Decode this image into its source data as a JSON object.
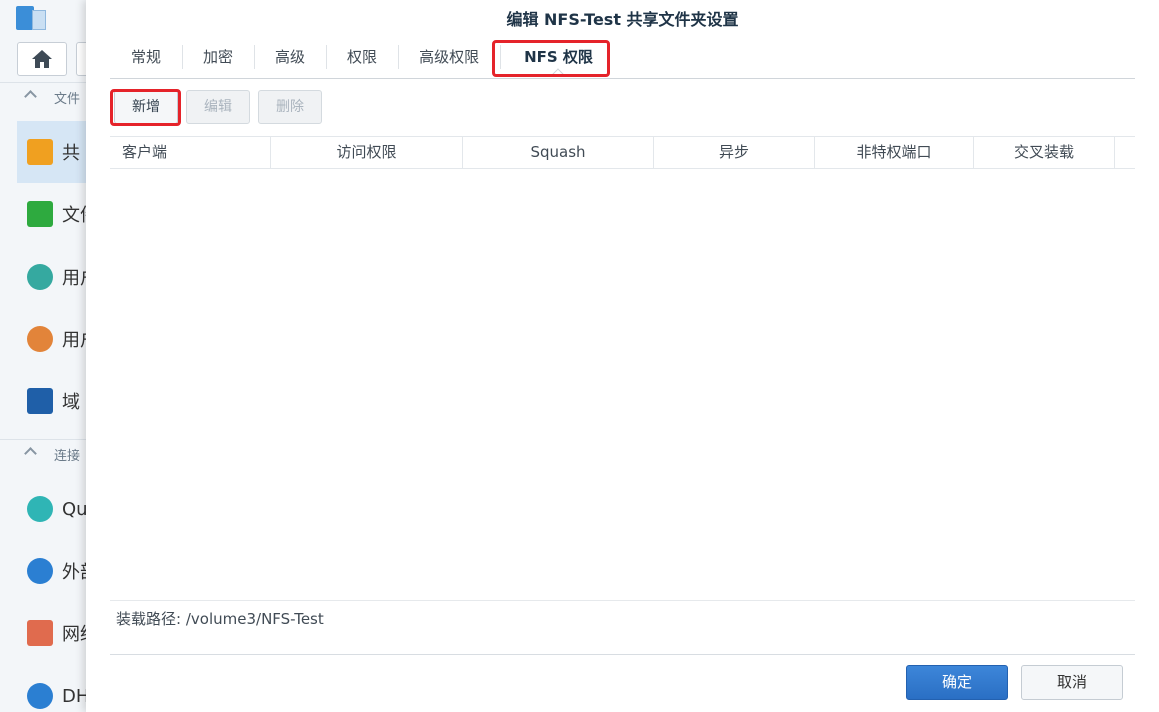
{
  "background": {
    "sections": [
      {
        "label": "文件"
      },
      {
        "label": "连接"
      }
    ],
    "items": [
      {
        "label": "共",
        "icon": "shared-folder-icon",
        "color": "#f0a020"
      },
      {
        "label": "文件",
        "icon": "file-services-icon",
        "color": "#2eaa3f"
      },
      {
        "label": "用户",
        "icon": "user-icon",
        "color": "#35a9a0"
      },
      {
        "label": "用户",
        "icon": "group-icon",
        "color": "#e2843a"
      },
      {
        "label": "域",
        "icon": "domain-icon",
        "color": "#1f5fa8"
      },
      {
        "label": "Qu",
        "icon": "quickconnect-icon",
        "color": "#2fb5b5"
      },
      {
        "label": "外部",
        "icon": "external-access-icon",
        "color": "#2b7fd2"
      },
      {
        "label": "网络",
        "icon": "network-icon",
        "color": "#e06b4e"
      },
      {
        "label": "DH",
        "icon": "dhcp-icon",
        "color": "#2b7fd2"
      }
    ]
  },
  "dialog": {
    "title": "编辑 NFS-Test 共享文件夹设置",
    "tabs": [
      {
        "label": "常规"
      },
      {
        "label": "加密"
      },
      {
        "label": "高级"
      },
      {
        "label": "权限"
      },
      {
        "label": "高级权限"
      },
      {
        "label": "NFS 权限"
      }
    ],
    "active_tab": "NFS 权限",
    "toolbar": {
      "add": "新增",
      "edit": "编辑",
      "delete": "删除"
    },
    "columns": [
      {
        "label": "客户端"
      },
      {
        "label": "访问权限"
      },
      {
        "label": "Squash"
      },
      {
        "label": "异步"
      },
      {
        "label": "非特权端口"
      },
      {
        "label": "交叉装载"
      }
    ],
    "rows": [],
    "mount_path_label": "装载路径:",
    "mount_path": "/volume3/NFS-Test",
    "ok": "确定",
    "cancel": "取消"
  },
  "colors": {
    "highlight": "#e5232a",
    "primary": "#2a6fc4"
  }
}
